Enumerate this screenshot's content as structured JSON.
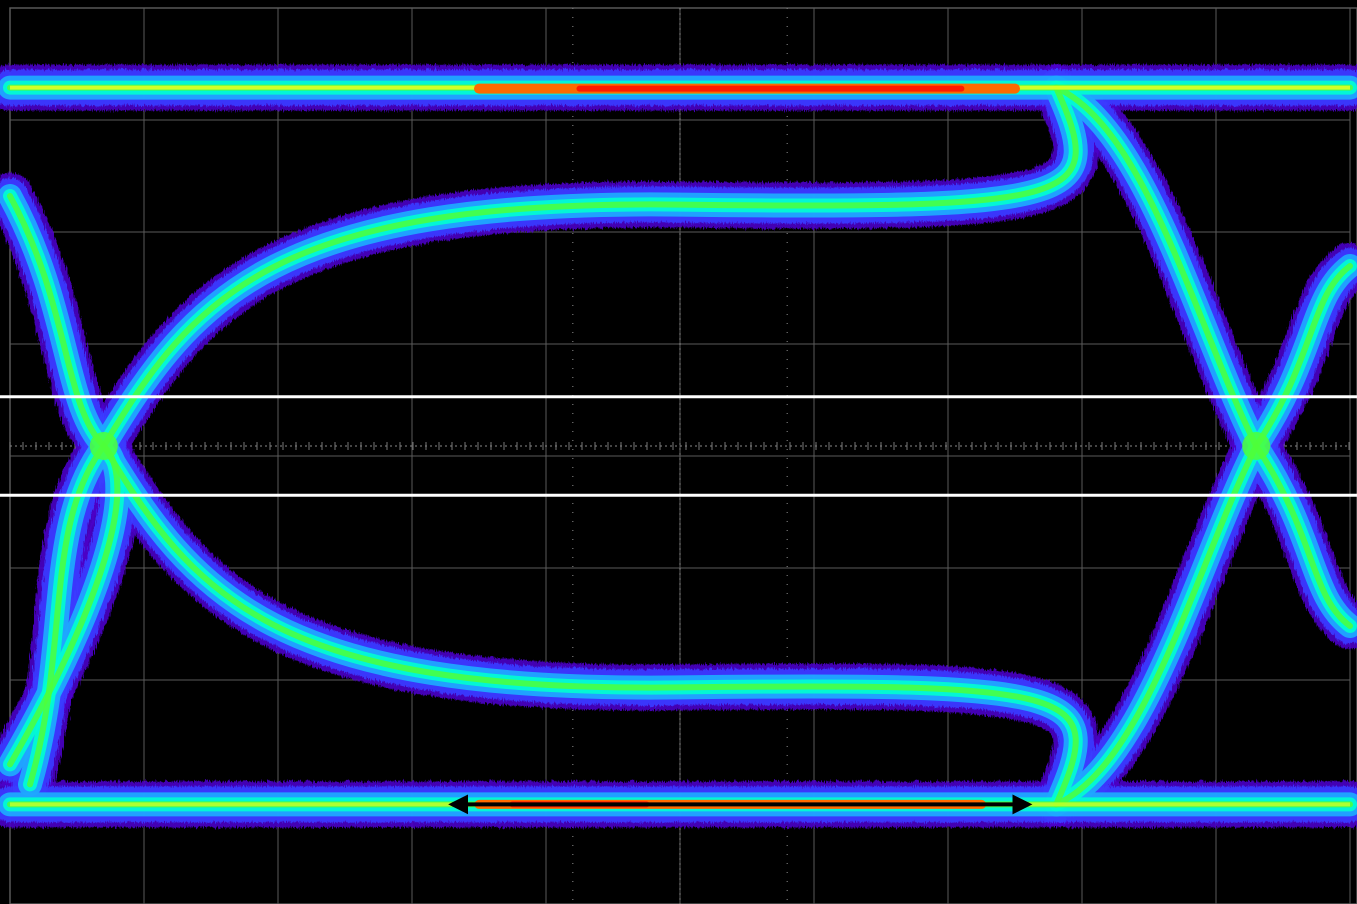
{
  "chart_data": {
    "type": "eye-diagram",
    "title": "",
    "xlabel": "",
    "ylabel": "",
    "grid": true,
    "grid_divisions": {
      "x": 10,
      "y": 8
    },
    "xlim": [
      -1.0,
      1.0
    ],
    "ylim": [
      -1.0,
      1.0
    ],
    "levels": {
      "high": 0.8,
      "low": -0.8
    },
    "crossings": [
      {
        "ui": -0.86,
        "level": 0.0
      },
      {
        "ui": 0.86,
        "level": 0.0
      }
    ],
    "eye_opening": {
      "top": 0.55,
      "bottom": -0.55
    },
    "threshold_band": [
      -0.11,
      0.11
    ],
    "eye_width_marker": {
      "x_start": -0.34,
      "x_end": 0.52,
      "level": -0.8
    },
    "density_colormap": [
      "#4b00c8",
      "#3a3aff",
      "#1fa8ff",
      "#00ffd2",
      "#4dff3a",
      "#f6ff1e",
      "#ff6a00",
      "#ff1a00"
    ]
  }
}
